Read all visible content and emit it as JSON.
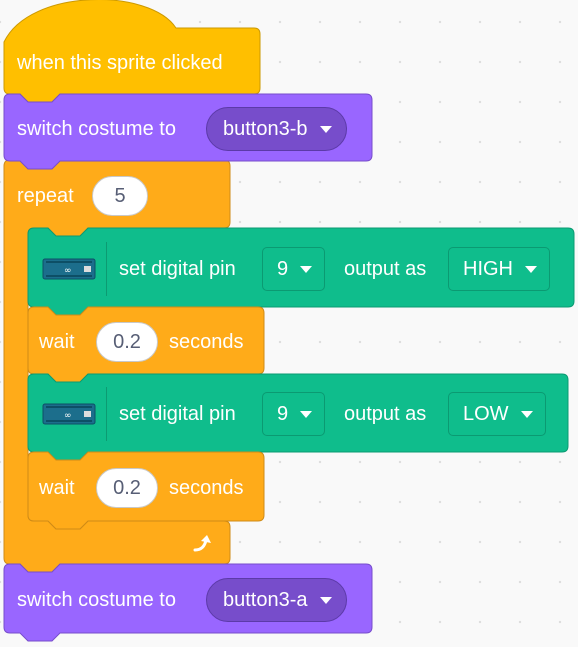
{
  "colors": {
    "events": "#FFBF00",
    "looks": "#9966FF",
    "control": "#FFAB19",
    "extension": "#0FBD8C"
  },
  "blocks": {
    "hat": {
      "label": "when this sprite clicked"
    },
    "switch_costume_1": {
      "label": "switch costume to",
      "value": "button3-b"
    },
    "repeat": {
      "label": "repeat",
      "value": "5",
      "loop_icon": "rotate-arrow-icon"
    },
    "set_pin_1": {
      "icon": "arduino-board-icon",
      "label": "set digital pin",
      "pin": "9",
      "output_label": "output as",
      "output": "HIGH"
    },
    "wait_1": {
      "label": "wait",
      "value": "0.2",
      "unit": "seconds"
    },
    "set_pin_2": {
      "icon": "arduino-board-icon",
      "label": "set digital pin",
      "pin": "9",
      "output_label": "output as",
      "output": "LOW"
    },
    "wait_2": {
      "label": "wait",
      "value": "0.2",
      "unit": "seconds"
    },
    "switch_costume_2": {
      "label": "switch costume to",
      "value": "button3-a"
    }
  }
}
